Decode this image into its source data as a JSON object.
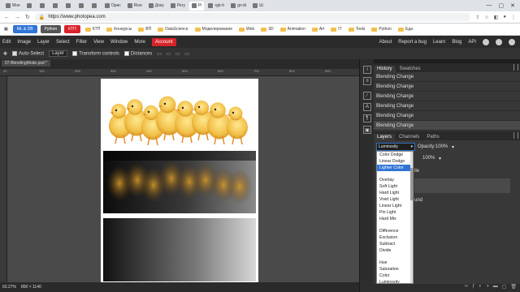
{
  "browser": {
    "tabs": [
      {
        "label": "Мое",
        "active": false
      },
      {
        "label": "",
        "active": false
      },
      {
        "label": "",
        "active": false
      },
      {
        "label": "",
        "active": false
      },
      {
        "label": "",
        "active": false
      },
      {
        "label": "",
        "active": false
      },
      {
        "label": "",
        "active": false
      },
      {
        "label": "Орис",
        "active": false
      },
      {
        "label": "Rive",
        "active": false
      },
      {
        "label": "Доку",
        "active": false
      },
      {
        "label": "Регу",
        "active": false
      },
      {
        "label": "Pi",
        "active": true
      },
      {
        "label": "rgb-h",
        "active": false
      },
      {
        "label": "gn-bi",
        "active": false
      },
      {
        "label": "Ш",
        "active": false
      }
    ],
    "url": "https://www.photopea.com",
    "bookmarks": [
      {
        "label": "КТП",
        "chip": false
      },
      {
        "label": "Конкурсы",
        "chip": false
      },
      {
        "label": "ВП",
        "chip": false
      },
      {
        "label": "DataScience",
        "chip": false
      },
      {
        "label": "Моделирование",
        "chip": false
      },
      {
        "label": "Web",
        "chip": false
      },
      {
        "label": "3D",
        "chip": false
      },
      {
        "label": "Animation",
        "chip": false
      },
      {
        "label": "Art",
        "chip": false
      },
      {
        "label": "IT",
        "chip": false
      },
      {
        "label": "Tools",
        "chip": false
      },
      {
        "label": "Python",
        "chip": false
      },
      {
        "label": "Еда",
        "chip": false
      }
    ],
    "bookmark_chips": [
      {
        "label": "ML & DB",
        "color": "#2f74d6"
      },
      {
        "label": "Python",
        "color": "#555555"
      },
      {
        "label": "КТП",
        "color": "#d8232a"
      }
    ]
  },
  "menu": {
    "items": [
      "Edit",
      "Image",
      "Layer",
      "Select",
      "Filter",
      "View",
      "Window",
      "More"
    ],
    "account": "Account",
    "right": [
      "About",
      "Report a bug",
      "Learn",
      "Blog",
      "API"
    ]
  },
  "options": {
    "auto_select": "Auto-Select",
    "target": "Layer",
    "transform": "Transform controls",
    "distances": "Distances"
  },
  "document": {
    "tab": "07-BlendingMode.psd *",
    "ruler": [
      "00",
      "100",
      "200",
      "300",
      "400",
      "500",
      "600",
      "700",
      "800",
      "900",
      "1000"
    ]
  },
  "status": {
    "zoom": "63.27%",
    "size": "800 × 1140"
  },
  "history": {
    "tabs": [
      "History",
      "Swatches"
    ],
    "items": [
      "Blending Change",
      "Blending Change",
      "Blending Change",
      "Blending Change",
      "Blending Change",
      "Blending Change"
    ]
  },
  "layers": {
    "tabs": [
      "Layers",
      "Channels",
      "Paths"
    ],
    "blend_mode": "Luminosity",
    "opacity_label": "Opacity:",
    "opacity": "100%",
    "fill": "100%",
    "partial_labels": [
      "ile",
      "und"
    ]
  },
  "blend_dropdown": {
    "groups": [
      [
        "Color Dodge",
        "Linear Dodge",
        "Lighter Color"
      ],
      [
        "Overlay",
        "Soft Light",
        "Hard Light",
        "Vivid Light",
        "Linear Light",
        "Pin Light",
        "Hard Mix"
      ],
      [
        "Difference",
        "Exclusion",
        "Subtract",
        "Divide"
      ],
      [
        "Hue",
        "Saturation",
        "Color",
        "Luminosity"
      ]
    ],
    "highlighted": "Lighter Color"
  },
  "colors": {
    "accent": "#2f74d6",
    "account": "#d8232a"
  }
}
